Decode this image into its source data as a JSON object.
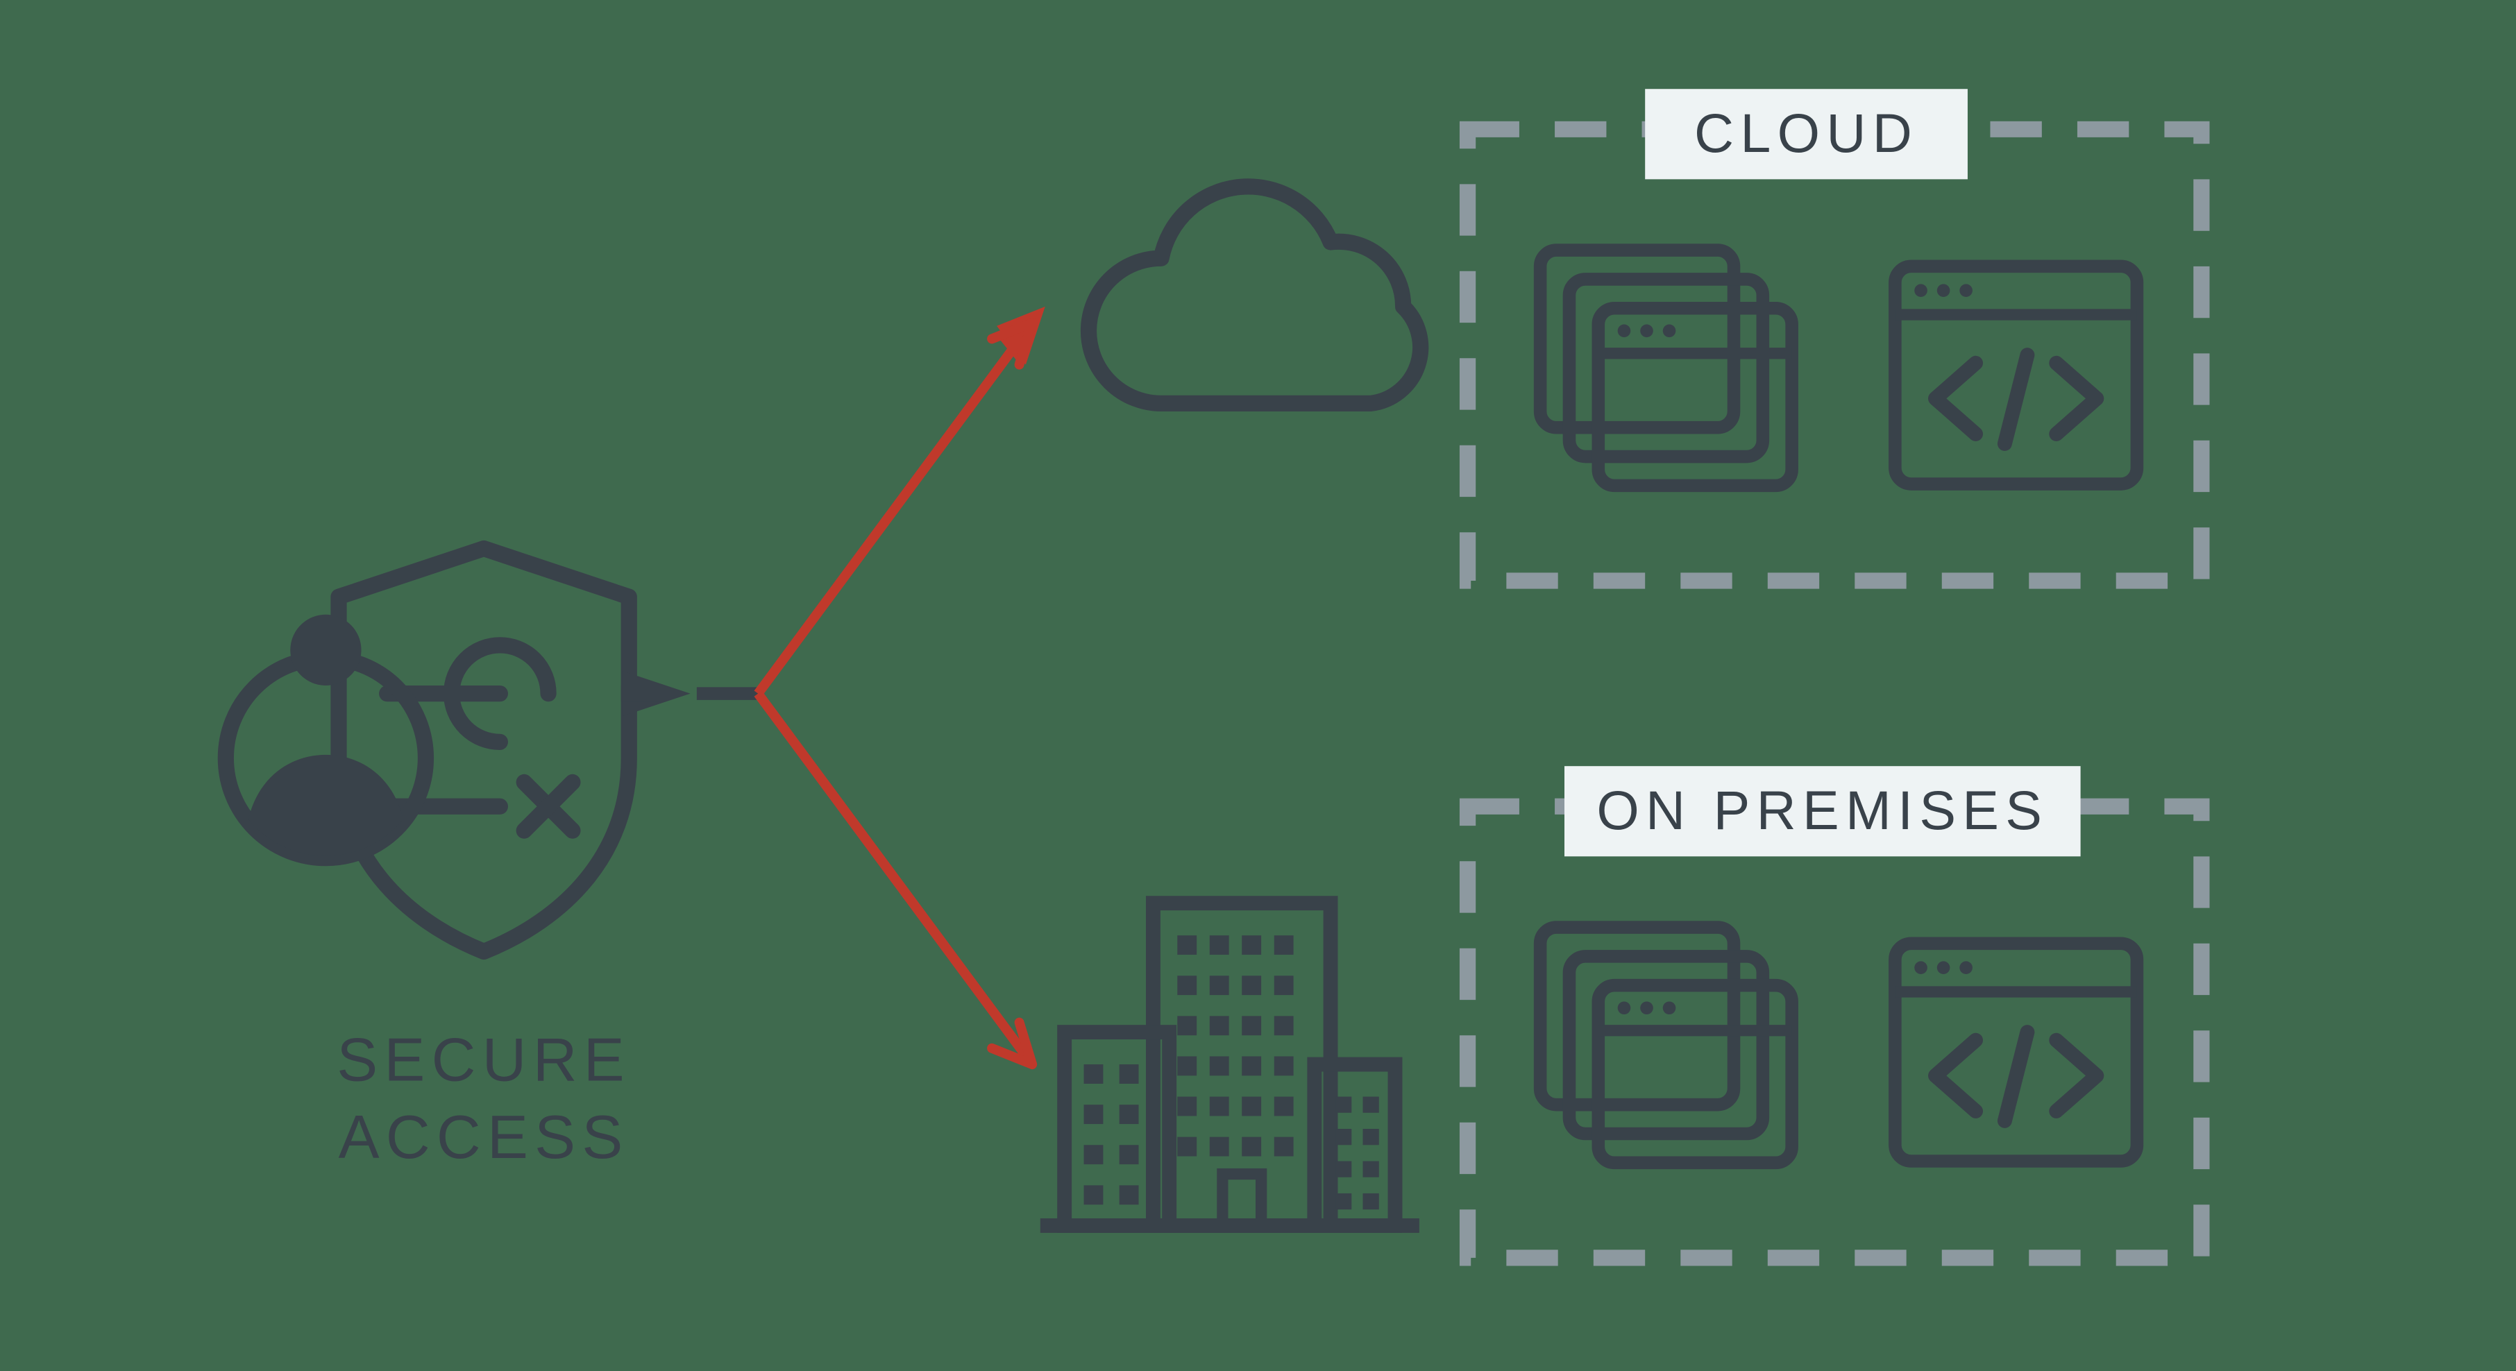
{
  "diagram": {
    "source_label_line1": "SECURE",
    "source_label_line2": "ACCESS",
    "targets": {
      "top": {
        "label": "CLOUD",
        "icon": "cloud"
      },
      "bottom": {
        "label": "ON PREMISES",
        "icon": "building"
      }
    },
    "box_contents": [
      "windows-stack",
      "code-window"
    ]
  },
  "colors": {
    "background": "#3f6a4e",
    "dark": "#39424a",
    "grey": "#8d99a0",
    "red": "#c0392b",
    "label_bg": "#eef3f4"
  }
}
